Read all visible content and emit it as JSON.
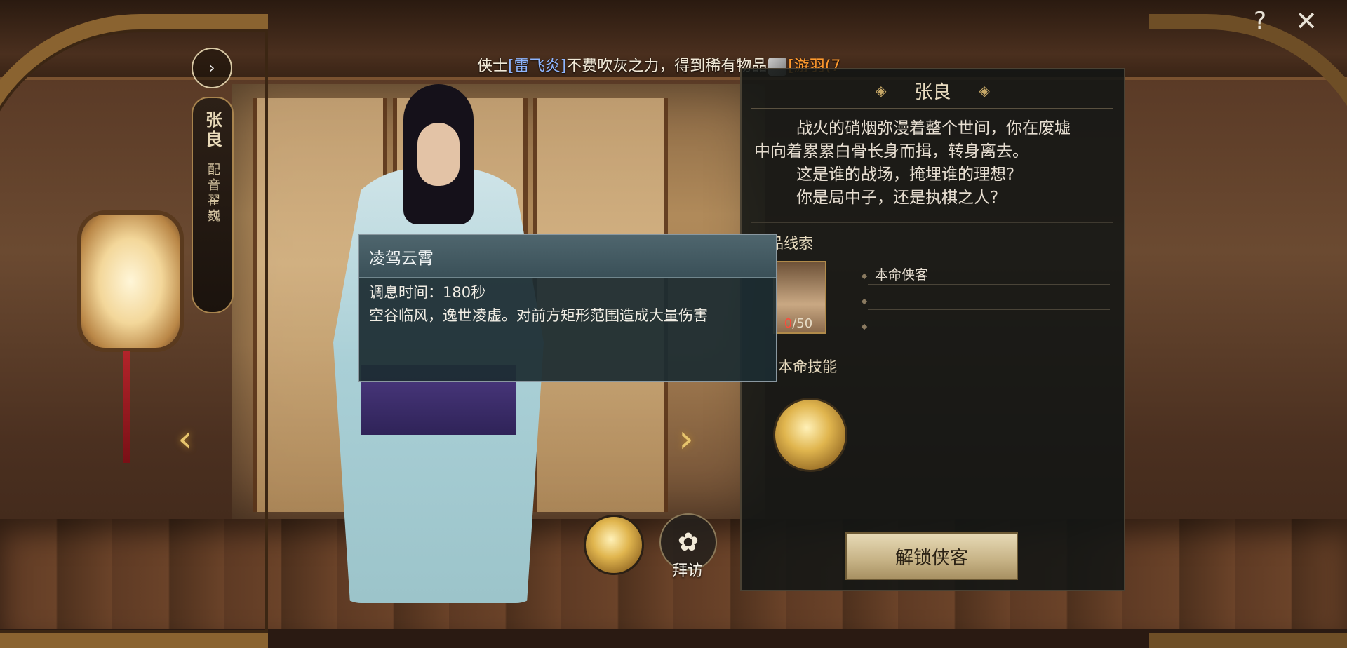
{
  "marquee": {
    "prefix": "侠士",
    "player": "[雷飞炎]",
    "middle": "不费吹灰之力，得到稀有物品",
    "item": "[游羽(7"
  },
  "top_icons": {
    "help": "?",
    "close": "✕"
  },
  "character": {
    "name": "张良",
    "voice_actor": "配音翟巍",
    "menu_button": "›"
  },
  "nav": {
    "prev": "‹",
    "next": "›"
  },
  "tooltip": {
    "title": "凌驾云霄",
    "cooldown": "调息时间：180秒",
    "description": "空谷临风，逸世凌虚。对前方矩形范围造成大量伤害"
  },
  "info_panel": {
    "title": "张良",
    "story": [
      "战火的硝烟弥漫着整个世间，你在废墟",
      "中向着累累白骨长身而揖，转身离去。",
      "这是谁的战场，掩埋谁的理想?",
      "你是局中子，还是执棋之人?"
    ],
    "clue_section": "信品线索",
    "clue_count_current": "0",
    "clue_count_total": "/50",
    "clue_items": [
      "本命侠客",
      "",
      ""
    ],
    "skill_section": "本命技能",
    "unlock_button": "解锁侠客"
  },
  "bottom_buttons": {
    "visit_label": "拜访",
    "visit_icon": "flower-icon",
    "skill_icon": "character-skill-icon"
  }
}
